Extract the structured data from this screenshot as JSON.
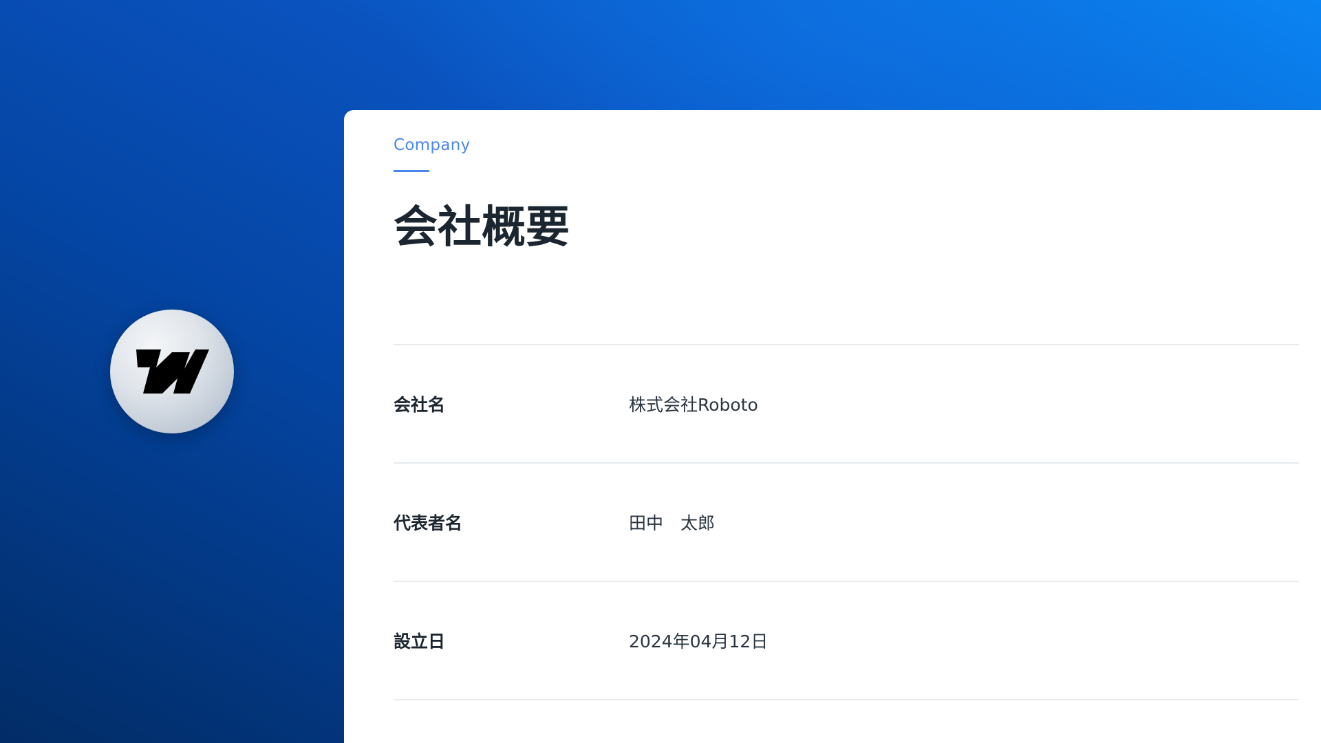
{
  "logo": {
    "icon": "webflow-w-icon",
    "badge_color": "#dfe4ea",
    "glyph_color": "#000000"
  },
  "section": {
    "eyebrow": "Company",
    "title": "会社概要",
    "accent_color": "#4a86ea"
  },
  "company_info": {
    "rows": [
      {
        "label": "会社名",
        "value": "株式会社Roboto"
      },
      {
        "label": "代表者名",
        "value": "田中　太郎"
      },
      {
        "label": "設立日",
        "value": "2024年04月12日"
      }
    ]
  },
  "colors": {
    "background_dark": "#022c66",
    "background_light": "#0a84f2",
    "card_background": "#ffffff",
    "text_primary": "#1c2630",
    "divider": "#e8ebee"
  }
}
